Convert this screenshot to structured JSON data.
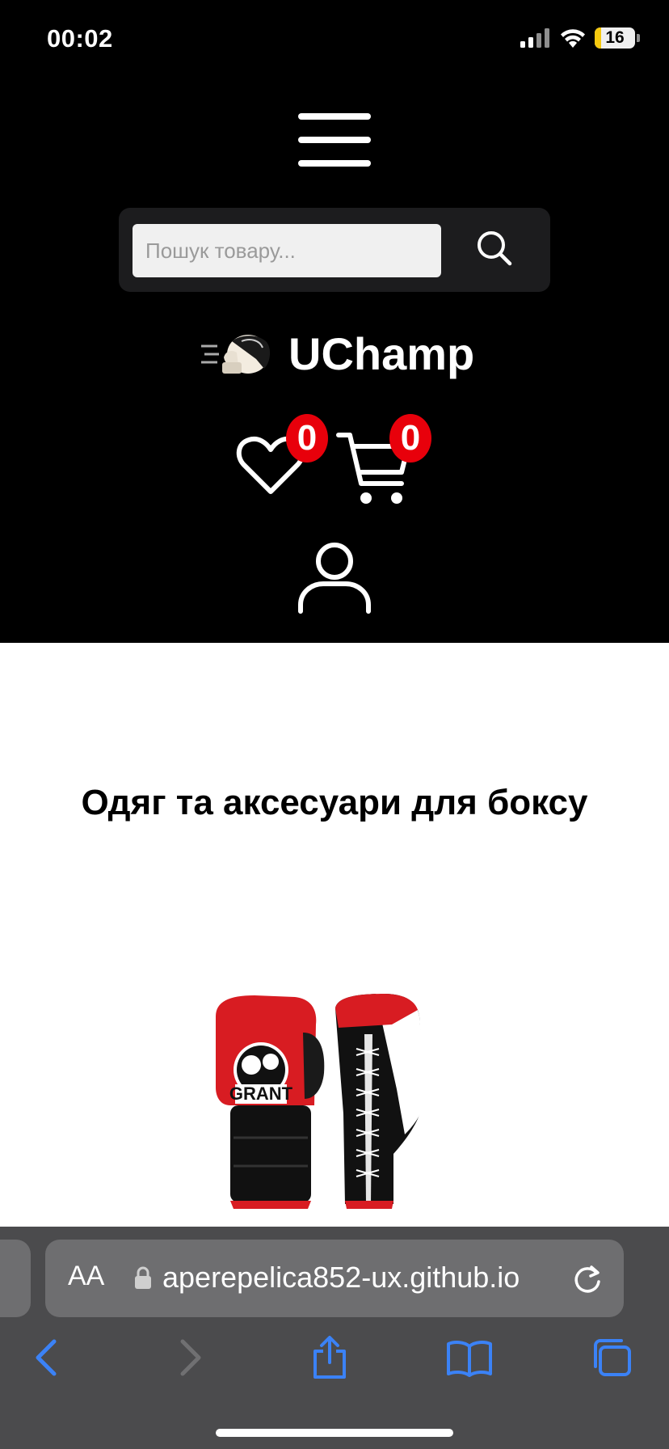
{
  "status_bar": {
    "time": "00:02",
    "battery_level": "16",
    "icons": [
      "cellular-signal-icon",
      "wifi-icon",
      "battery-icon"
    ]
  },
  "header": {
    "menu_icon": "hamburger-menu-icon",
    "search": {
      "placeholder": "Пошук товару...",
      "value": "",
      "button_icon": "search-icon"
    },
    "logo": {
      "icon": "boxing-glove-logo",
      "text": "UChamp"
    },
    "wishlist": {
      "icon": "heart-icon",
      "count": "0"
    },
    "cart": {
      "icon": "cart-icon",
      "count": "0"
    },
    "account_icon": "user-icon"
  },
  "main": {
    "section_title": "Одяг та аксесуари для боксу",
    "product_image": {
      "icon": "boxing-gloves-image",
      "brand_text": "GRANT",
      "colors": {
        "primary": "#d81c22",
        "secondary": "#111111",
        "accent": "#ffffff"
      }
    }
  },
  "browser": {
    "aa_label": "AA",
    "url": "aperepelica852-ux.github.io",
    "icons": [
      "lock-icon",
      "reload-icon",
      "back-icon",
      "forward-icon",
      "share-icon",
      "bookmarks-icon",
      "tabs-icon"
    ],
    "accent_color": "#3b82f6"
  }
}
